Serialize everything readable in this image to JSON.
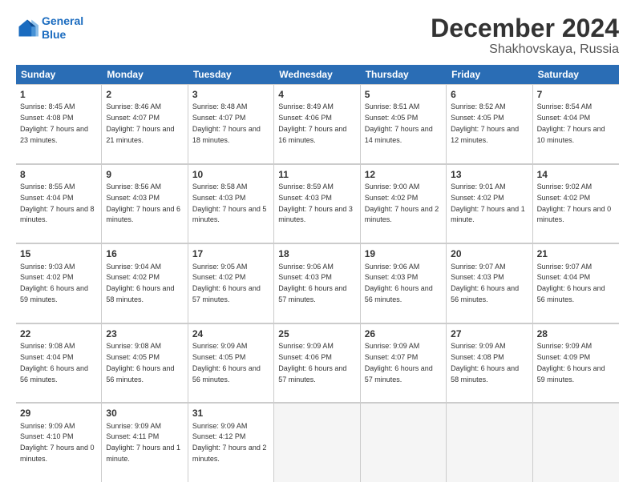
{
  "header": {
    "logo_line1": "General",
    "logo_line2": "Blue",
    "title": "December 2024",
    "subtitle": "Shakhovskaya, Russia"
  },
  "days": [
    "Sunday",
    "Monday",
    "Tuesday",
    "Wednesday",
    "Thursday",
    "Friday",
    "Saturday"
  ],
  "weeks": [
    [
      {
        "day": "1",
        "sunrise": "Sunrise: 8:45 AM",
        "sunset": "Sunset: 4:08 PM",
        "daylight": "Daylight: 7 hours and 23 minutes."
      },
      {
        "day": "2",
        "sunrise": "Sunrise: 8:46 AM",
        "sunset": "Sunset: 4:07 PM",
        "daylight": "Daylight: 7 hours and 21 minutes."
      },
      {
        "day": "3",
        "sunrise": "Sunrise: 8:48 AM",
        "sunset": "Sunset: 4:07 PM",
        "daylight": "Daylight: 7 hours and 18 minutes."
      },
      {
        "day": "4",
        "sunrise": "Sunrise: 8:49 AM",
        "sunset": "Sunset: 4:06 PM",
        "daylight": "Daylight: 7 hours and 16 minutes."
      },
      {
        "day": "5",
        "sunrise": "Sunrise: 8:51 AM",
        "sunset": "Sunset: 4:05 PM",
        "daylight": "Daylight: 7 hours and 14 minutes."
      },
      {
        "day": "6",
        "sunrise": "Sunrise: 8:52 AM",
        "sunset": "Sunset: 4:05 PM",
        "daylight": "Daylight: 7 hours and 12 minutes."
      },
      {
        "day": "7",
        "sunrise": "Sunrise: 8:54 AM",
        "sunset": "Sunset: 4:04 PM",
        "daylight": "Daylight: 7 hours and 10 minutes."
      }
    ],
    [
      {
        "day": "8",
        "sunrise": "Sunrise: 8:55 AM",
        "sunset": "Sunset: 4:04 PM",
        "daylight": "Daylight: 7 hours and 8 minutes."
      },
      {
        "day": "9",
        "sunrise": "Sunrise: 8:56 AM",
        "sunset": "Sunset: 4:03 PM",
        "daylight": "Daylight: 7 hours and 6 minutes."
      },
      {
        "day": "10",
        "sunrise": "Sunrise: 8:58 AM",
        "sunset": "Sunset: 4:03 PM",
        "daylight": "Daylight: 7 hours and 5 minutes."
      },
      {
        "day": "11",
        "sunrise": "Sunrise: 8:59 AM",
        "sunset": "Sunset: 4:03 PM",
        "daylight": "Daylight: 7 hours and 3 minutes."
      },
      {
        "day": "12",
        "sunrise": "Sunrise: 9:00 AM",
        "sunset": "Sunset: 4:02 PM",
        "daylight": "Daylight: 7 hours and 2 minutes."
      },
      {
        "day": "13",
        "sunrise": "Sunrise: 9:01 AM",
        "sunset": "Sunset: 4:02 PM",
        "daylight": "Daylight: 7 hours and 1 minute."
      },
      {
        "day": "14",
        "sunrise": "Sunrise: 9:02 AM",
        "sunset": "Sunset: 4:02 PM",
        "daylight": "Daylight: 7 hours and 0 minutes."
      }
    ],
    [
      {
        "day": "15",
        "sunrise": "Sunrise: 9:03 AM",
        "sunset": "Sunset: 4:02 PM",
        "daylight": "Daylight: 6 hours and 59 minutes."
      },
      {
        "day": "16",
        "sunrise": "Sunrise: 9:04 AM",
        "sunset": "Sunset: 4:02 PM",
        "daylight": "Daylight: 6 hours and 58 minutes."
      },
      {
        "day": "17",
        "sunrise": "Sunrise: 9:05 AM",
        "sunset": "Sunset: 4:02 PM",
        "daylight": "Daylight: 6 hours and 57 minutes."
      },
      {
        "day": "18",
        "sunrise": "Sunrise: 9:06 AM",
        "sunset": "Sunset: 4:03 PM",
        "daylight": "Daylight: 6 hours and 57 minutes."
      },
      {
        "day": "19",
        "sunrise": "Sunrise: 9:06 AM",
        "sunset": "Sunset: 4:03 PM",
        "daylight": "Daylight: 6 hours and 56 minutes."
      },
      {
        "day": "20",
        "sunrise": "Sunrise: 9:07 AM",
        "sunset": "Sunset: 4:03 PM",
        "daylight": "Daylight: 6 hours and 56 minutes."
      },
      {
        "day": "21",
        "sunrise": "Sunrise: 9:07 AM",
        "sunset": "Sunset: 4:04 PM",
        "daylight": "Daylight: 6 hours and 56 minutes."
      }
    ],
    [
      {
        "day": "22",
        "sunrise": "Sunrise: 9:08 AM",
        "sunset": "Sunset: 4:04 PM",
        "daylight": "Daylight: 6 hours and 56 minutes."
      },
      {
        "day": "23",
        "sunrise": "Sunrise: 9:08 AM",
        "sunset": "Sunset: 4:05 PM",
        "daylight": "Daylight: 6 hours and 56 minutes."
      },
      {
        "day": "24",
        "sunrise": "Sunrise: 9:09 AM",
        "sunset": "Sunset: 4:05 PM",
        "daylight": "Daylight: 6 hours and 56 minutes."
      },
      {
        "day": "25",
        "sunrise": "Sunrise: 9:09 AM",
        "sunset": "Sunset: 4:06 PM",
        "daylight": "Daylight: 6 hours and 57 minutes."
      },
      {
        "day": "26",
        "sunrise": "Sunrise: 9:09 AM",
        "sunset": "Sunset: 4:07 PM",
        "daylight": "Daylight: 6 hours and 57 minutes."
      },
      {
        "day": "27",
        "sunrise": "Sunrise: 9:09 AM",
        "sunset": "Sunset: 4:08 PM",
        "daylight": "Daylight: 6 hours and 58 minutes."
      },
      {
        "day": "28",
        "sunrise": "Sunrise: 9:09 AM",
        "sunset": "Sunset: 4:09 PM",
        "daylight": "Daylight: 6 hours and 59 minutes."
      }
    ],
    [
      {
        "day": "29",
        "sunrise": "Sunrise: 9:09 AM",
        "sunset": "Sunset: 4:10 PM",
        "daylight": "Daylight: 7 hours and 0 minutes."
      },
      {
        "day": "30",
        "sunrise": "Sunrise: 9:09 AM",
        "sunset": "Sunset: 4:11 PM",
        "daylight": "Daylight: 7 hours and 1 minute."
      },
      {
        "day": "31",
        "sunrise": "Sunrise: 9:09 AM",
        "sunset": "Sunset: 4:12 PM",
        "daylight": "Daylight: 7 hours and 2 minutes."
      },
      null,
      null,
      null,
      null
    ]
  ]
}
